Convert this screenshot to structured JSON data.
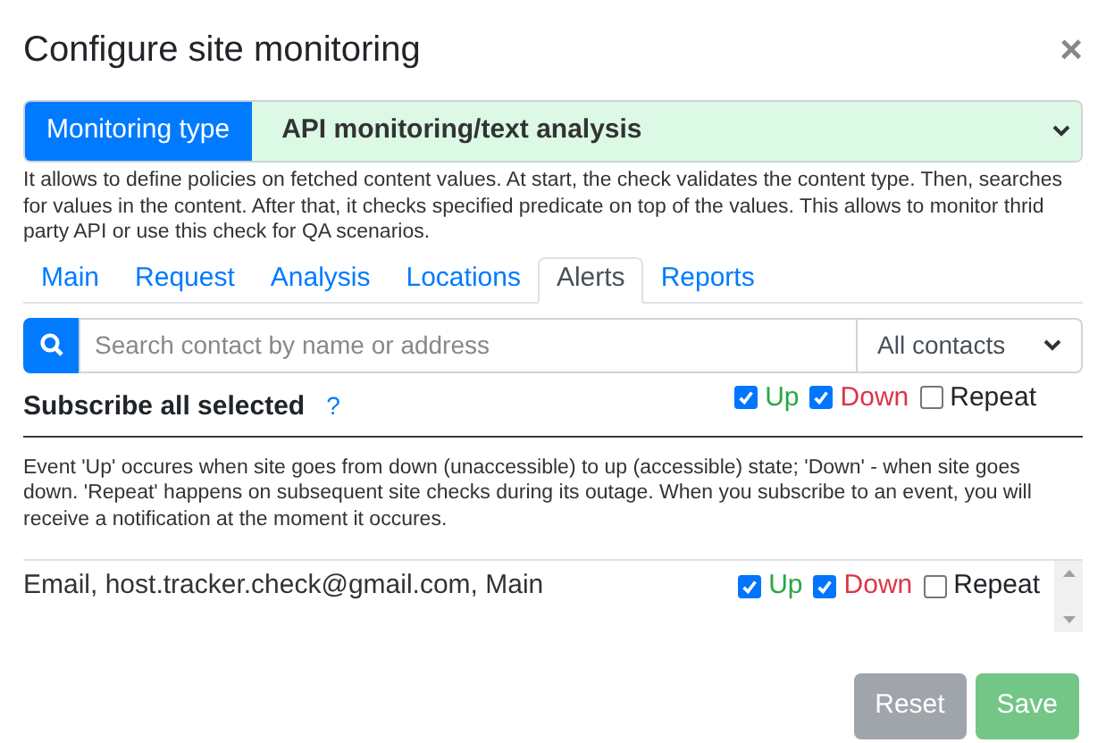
{
  "dialog": {
    "title": "Configure site monitoring",
    "close": "×"
  },
  "monitoring_type": {
    "label": "Monitoring type",
    "value": "API monitoring/text analysis"
  },
  "description": "It allows to define policies on fetched content values. At start, the check validates the content type. Then, searches for values in the content. After that, it checks specified predicate on top of the values. This allows to monitor thrid party API or use this check for QA scenarios.",
  "tabs": [
    {
      "label": "Main",
      "selected": false
    },
    {
      "label": "Request",
      "selected": false
    },
    {
      "label": "Analysis",
      "selected": false
    },
    {
      "label": "Locations",
      "selected": false
    },
    {
      "label": "Alerts",
      "selected": true
    },
    {
      "label": "Reports",
      "selected": false
    }
  ],
  "search": {
    "placeholder": "Search contact by name or address",
    "filter": "All contacts"
  },
  "subscribe_all": {
    "label": "Subscribe all selected",
    "help": "?",
    "events": [
      {
        "kind": "up",
        "label": "Up",
        "checked": true
      },
      {
        "kind": "down",
        "label": "Down",
        "checked": true
      },
      {
        "kind": "repeat",
        "label": "Repeat",
        "checked": false
      }
    ]
  },
  "event_help": "Event 'Up' occures when site goes from down (unaccessible) to up (accessible) state; 'Down' - when site goes down. 'Repeat' happens on subsequent site checks during its outage. When you subscribe to an event, you will receive a notification at the moment it occures.",
  "contacts": [
    {
      "name": "Email, host.tracker.check@gmail.com, Main",
      "events": [
        {
          "kind": "up",
          "label": "Up",
          "checked": true
        },
        {
          "kind": "down",
          "label": "Down",
          "checked": true
        },
        {
          "kind": "repeat",
          "label": "Repeat",
          "checked": false
        }
      ]
    }
  ],
  "buttons": [
    {
      "kind": "secondary",
      "label": "Reset",
      "disabled": true
    },
    {
      "kind": "success",
      "label": "Save",
      "disabled": true
    }
  ]
}
